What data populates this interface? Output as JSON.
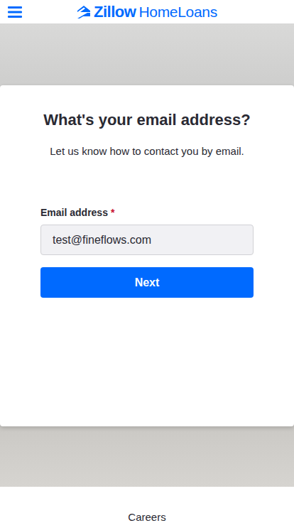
{
  "header": {
    "logo": {
      "brand": "Zillow",
      "product": "HomeLoans"
    }
  },
  "form": {
    "title": "What's your email address?",
    "subtitle": "Let us know how to contact you by email.",
    "field": {
      "label": "Email address",
      "required_mark": "*",
      "value": "test@fineflows.com"
    },
    "button": "Next"
  },
  "footer": {
    "links": [
      "Careers"
    ]
  }
}
